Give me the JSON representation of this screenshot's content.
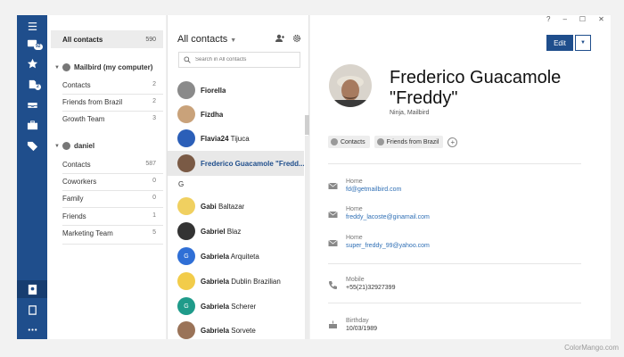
{
  "window": {
    "controls": [
      "?",
      "–",
      "☐",
      "✕"
    ]
  },
  "rail": {
    "badge_count": "92",
    "badge_count2": "2",
    "icons": [
      "menu-icon",
      "inbox-icon",
      "star-icon",
      "drafts-icon",
      "tray-icon",
      "briefcase-icon",
      "tag-icon",
      "contacts-icon",
      "notes-icon",
      "more-icon"
    ]
  },
  "groups": {
    "all_label": "All contacts",
    "all_count": "590",
    "accounts": [
      {
        "name": "Mailbird (my computer)",
        "items": [
          {
            "label": "Contacts",
            "count": "2"
          },
          {
            "label": "Friends from Brazil",
            "count": "2"
          },
          {
            "label": "Growth Team",
            "count": "3"
          }
        ]
      },
      {
        "name": "daniel",
        "items": [
          {
            "label": "Contacts",
            "count": "587"
          },
          {
            "label": "Coworkers",
            "count": "0"
          },
          {
            "label": "Family",
            "count": "0"
          },
          {
            "label": "Friends",
            "count": "1"
          },
          {
            "label": "Marketing Team",
            "count": "5"
          }
        ]
      }
    ]
  },
  "contacts_list": {
    "title": "All contacts",
    "search_placeholder": "Search in All contacts",
    "section_letter": "G",
    "rows": [
      {
        "bold": "Fiorella",
        "rest": ""
      },
      {
        "bold": "Fizdha",
        "rest": ""
      },
      {
        "bold": "Flavia24",
        "rest": " Tijuca"
      },
      {
        "bold": "Frederico Guacamole \"Fredd...",
        "rest": ""
      },
      {
        "bold": "Gabi",
        "rest": " Baltazar"
      },
      {
        "bold": "Gabriel",
        "rest": " Blaz"
      },
      {
        "bold": "Gabriela",
        "rest": " Arquiteta"
      },
      {
        "bold": "Gabriela",
        "rest": " Dublin Brazilian"
      },
      {
        "bold": "Gabriela",
        "rest": " Scherer"
      },
      {
        "bold": "Gabriela",
        "rest": " Sorvete"
      }
    ],
    "avatar_letters": [
      "G",
      "G"
    ]
  },
  "detail": {
    "edit_label": "Edit",
    "name": "Frederico Guacamole \"Freddy\"",
    "subtitle": "Ninja, Mailbird",
    "tags": [
      "Contacts",
      "Friends from Brazil"
    ],
    "emails": [
      {
        "label": "Home",
        "value": "fd@getmailbird.com"
      },
      {
        "label": "Home",
        "value": "freddy_lacoste@ginamail.com"
      },
      {
        "label": "Home",
        "value": "super_freddy_99@yahoo.com"
      }
    ],
    "phone": {
      "label": "Mobile",
      "value": "+55(21)32927399"
    },
    "birthday": {
      "label": "Birthday",
      "value": "10/03/1989"
    }
  },
  "watermark": "ColorMango.com"
}
